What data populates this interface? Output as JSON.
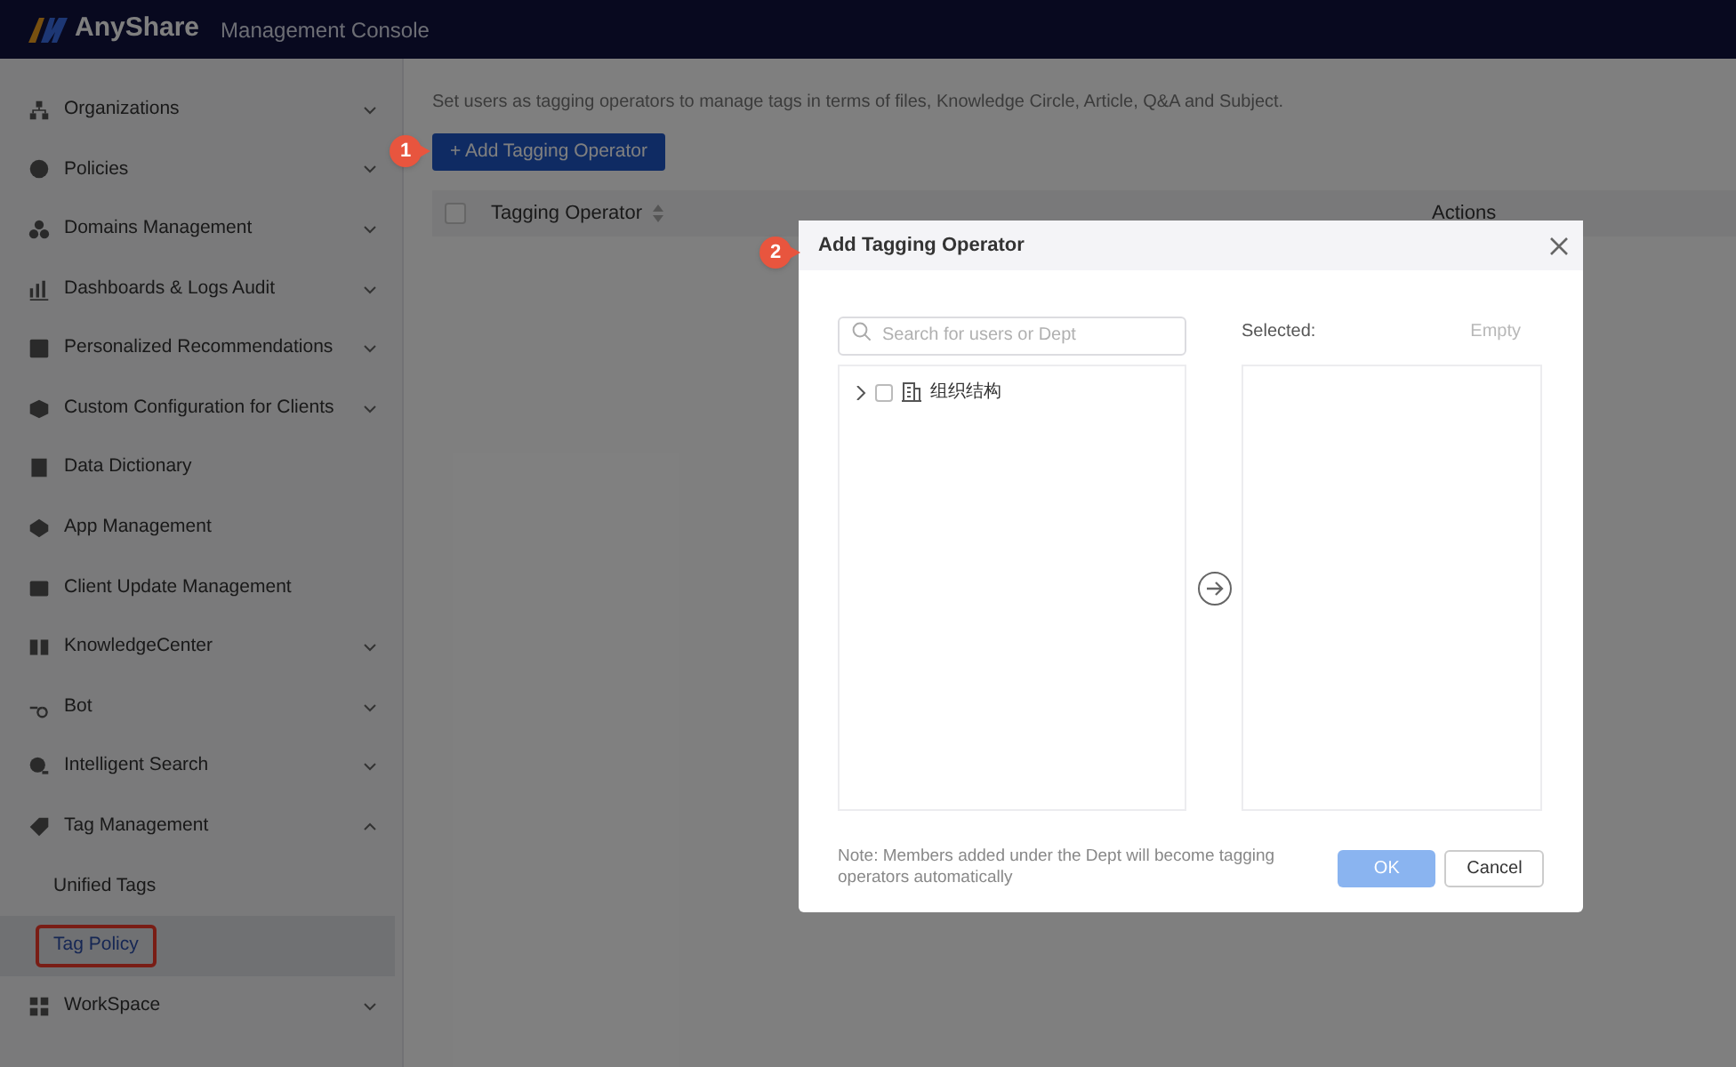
{
  "header": {
    "brand": "AnyShare",
    "title": "Management Console"
  },
  "sidebar": {
    "items": [
      {
        "label": "Organizations",
        "expanded": false
      },
      {
        "label": "Policies",
        "expanded": false
      },
      {
        "label": "Domains Management",
        "expanded": false
      },
      {
        "label": "Dashboards & Logs Audit",
        "expanded": false
      },
      {
        "label": "Personalized Recommendations",
        "expanded": false
      },
      {
        "label": "Custom Configuration for Clients",
        "expanded": false
      },
      {
        "label": "Data Dictionary"
      },
      {
        "label": "App Management"
      },
      {
        "label": "Client Update Management"
      },
      {
        "label": "KnowledgeCenter",
        "expanded": false
      },
      {
        "label": "Bot",
        "expanded": false
      },
      {
        "label": "Intelligent Search",
        "expanded": false
      },
      {
        "label": "Tag Management",
        "expanded": true,
        "children": [
          {
            "label": "Unified Tags",
            "selected": false,
            "outlined": false
          },
          {
            "label": "Tag Policy",
            "selected": true,
            "outlined": true
          }
        ]
      },
      {
        "label": "WorkSpace",
        "expanded": false
      }
    ]
  },
  "main": {
    "description": "Set users as tagging operators to manage tags in terms of files, Knowledge Circle, Article, Q&A and Subject.",
    "add_button": "+ Add Tagging Operator",
    "table": {
      "select_all_checked": false,
      "columns": [
        "Tagging Operator",
        "Actions"
      ]
    }
  },
  "dialog": {
    "title": "Add Tagging Operator",
    "search": {
      "placeholder": "Search for users or Dept"
    },
    "tree": [
      {
        "label": "组织结构",
        "expanded": false,
        "checked": false
      }
    ],
    "selected_label": "Selected:",
    "empty_label": "Empty",
    "note": "Note: Members added under the Dept will become tagging operators automatically",
    "buttons": [
      {
        "label": "OK",
        "kind": "primary",
        "disabled": true
      },
      {
        "label": "Cancel",
        "kind": "secondary",
        "disabled": false
      }
    ]
  },
  "callouts": [
    "1",
    "2"
  ]
}
